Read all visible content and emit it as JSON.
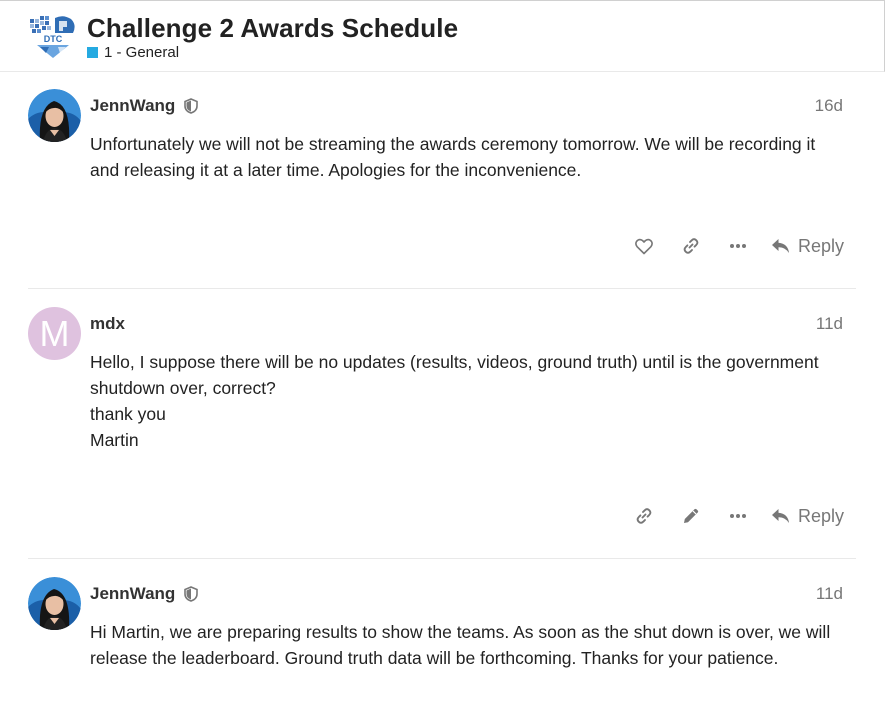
{
  "topic": {
    "title": "Challenge 2 Awards Schedule",
    "category": "1 - General",
    "category_color": "#25aae1",
    "logo_text": "DTC"
  },
  "posts": [
    {
      "username": "JennWang",
      "date": "16d",
      "is_staff": true,
      "paragraphs": [
        "Unfortunately we will not be streaming the awards ceremony tomorrow. We will be recording it and releasing it at a later time. Apologies for the inconvenience."
      ],
      "actions": [
        "heart-icon",
        "link-icon",
        "more-icon"
      ],
      "reply_label": "Reply"
    },
    {
      "username": "mdx",
      "date": "11d",
      "avatar_letter": "M",
      "avatar_color": "#dfc2df",
      "paragraphs": [
        "Hello, I suppose there will be no updates (results, videos, ground truth) until is the government shutdown over, correct?",
        "thank you",
        "Martin"
      ],
      "actions": [
        "link-icon",
        "pencil-icon",
        "more-icon"
      ],
      "reply_label": "Reply"
    },
    {
      "username": "JennWang",
      "date": "11d",
      "is_staff": true,
      "paragraphs": [
        "Hi Martin, we are preparing results to show the teams. As soon as the shut down is over, we will release the leaderboard. Ground truth data will be forthcoming. Thanks for your patience."
      ]
    }
  ]
}
